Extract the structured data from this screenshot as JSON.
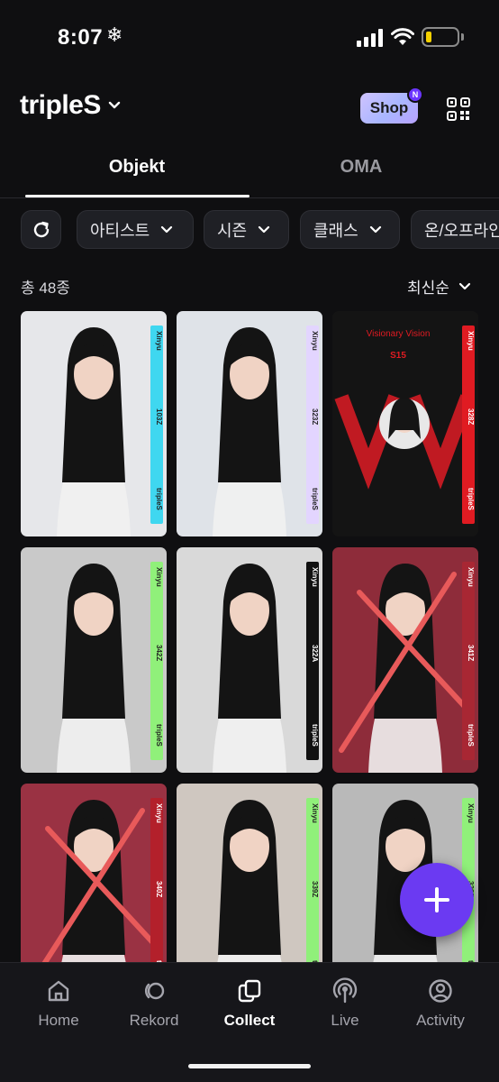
{
  "status_bar": {
    "time": "8:07",
    "weather_icon": "snowflake-icon",
    "glyph": "❄"
  },
  "header": {
    "artist": "tripleS",
    "shop_label": "Shop",
    "shop_badge": "N",
    "qr_icon": "qr-code-icon"
  },
  "tabs": [
    {
      "label": "Objekt",
      "active": true
    },
    {
      "label": "OMA",
      "active": false
    }
  ],
  "filters": {
    "refresh_icon": "refresh-icon",
    "chips": [
      {
        "label": "아티스트"
      },
      {
        "label": "시즌"
      },
      {
        "label": "클래스"
      },
      {
        "label": "온/오프라인"
      }
    ]
  },
  "list": {
    "count": "총 48종",
    "sort_label": "최신순"
  },
  "cards": [
    {
      "strip_color": "#3fd7f0",
      "member": "Xinyu",
      "code": "103Z",
      "group": "tripleS",
      "bg": "#e6e7ea"
    },
    {
      "strip_color": "#e3d5ff",
      "member": "Xinyu",
      "code": "323Z",
      "group": "tripleS",
      "bg": "#dfe3e8"
    },
    {
      "strip_color": "#e01b22",
      "member": "Xinyu",
      "code": "328Z",
      "group": "tripleS",
      "bg": "#141414",
      "top_text": "Visionary Vision",
      "season": "S15"
    },
    {
      "strip_color": "#90f07a",
      "member": "Xinyu",
      "code": "342Z",
      "group": "tripleS",
      "bg": "#c9c9c9"
    },
    {
      "strip_color": "#111111",
      "member": "Xinyu",
      "code": "322A",
      "group": "tripleS",
      "bg": "#d9d9d9"
    },
    {
      "strip_color": "#a82733",
      "member": "Xinyu",
      "code": "341Z",
      "group": "tripleS",
      "bg": "#8e2c3a"
    },
    {
      "strip_color": "#b3202b",
      "member": "Xinyu",
      "code": "340Z",
      "group": "tripleS",
      "bg": "#9a3243"
    },
    {
      "strip_color": "#90f07a",
      "member": "Xinyu",
      "code": "339Z",
      "group": "tripleS",
      "bg": "#cfc7c0"
    },
    {
      "strip_color": "#90f07a",
      "member": "Xinyu",
      "code": "338Z",
      "group": "tripleS",
      "bg": "#b9b9b9"
    }
  ],
  "fab": {
    "icon": "plus-icon"
  },
  "bottom_nav": [
    {
      "label": "Home",
      "icon": "home-icon",
      "active": false
    },
    {
      "label": "Rekord",
      "icon": "rekord-icon",
      "active": false
    },
    {
      "label": "Collect",
      "icon": "collect-icon",
      "active": true
    },
    {
      "label": "Live",
      "icon": "live-icon",
      "active": false
    },
    {
      "label": "Activity",
      "icon": "activity-icon",
      "active": false
    }
  ]
}
